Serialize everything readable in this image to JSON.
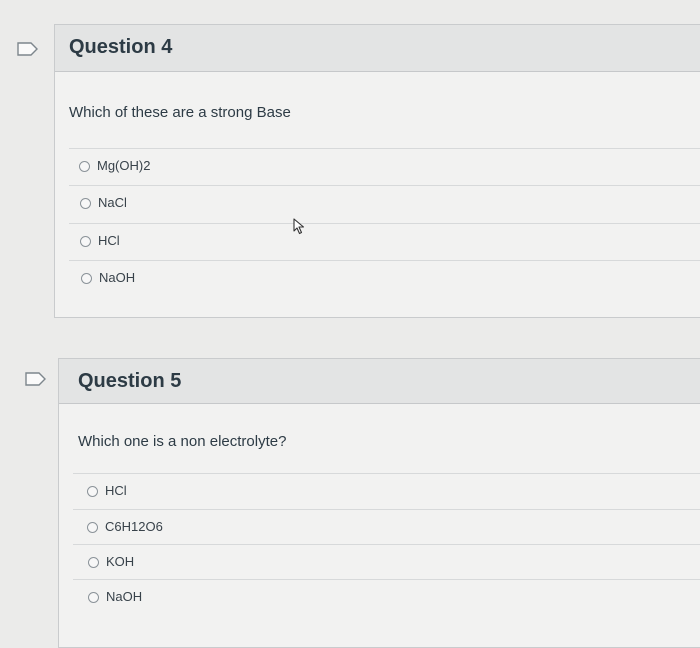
{
  "questions": [
    {
      "title": "Question 4",
      "prompt": "Which of these are a strong Base",
      "answers": [
        "Mg(OH)2",
        "NaCl",
        "HCl",
        "NaOH"
      ]
    },
    {
      "title": "Question 5",
      "prompt": "Which one is a non electrolyte?",
      "answers": [
        "HCl",
        "C6H12O6",
        "KOH",
        "NaOH"
      ]
    }
  ],
  "colors": {
    "background": "#ebebea",
    "card": "#f2f2f1",
    "header": "#e3e4e4",
    "text": "#2d3b45"
  },
  "icons": [
    "flag-icon",
    "radio-button",
    "mouse-pointer-icon"
  ]
}
